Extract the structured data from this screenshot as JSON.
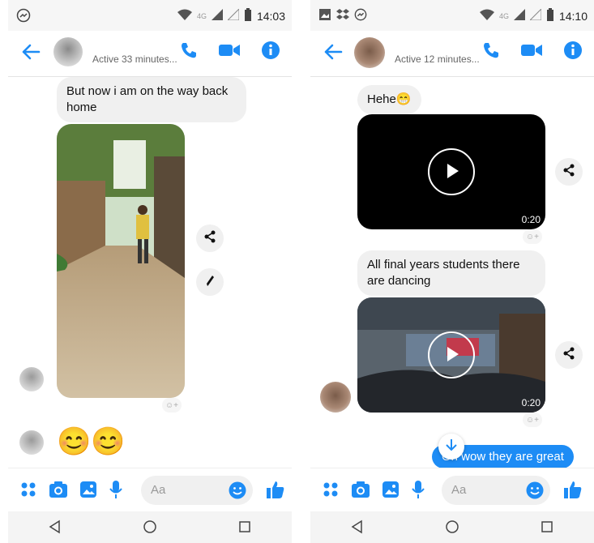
{
  "left": {
    "status": {
      "time": "14:03",
      "network": "4G"
    },
    "header": {
      "active": "Active 33 minutes..."
    },
    "messages": {
      "text1": "But now i am on the way back home",
      "emoji": "😊😊"
    },
    "composer": {
      "placeholder": "Aa"
    }
  },
  "right": {
    "status": {
      "time": "14:10",
      "network": "4G"
    },
    "header": {
      "active": "Active 12 minutes..."
    },
    "messages": {
      "hehe": "Hehe😁",
      "video1_duration": "0:20",
      "text2": "All final years students there are dancing",
      "video2_duration": "0:20",
      "outgoing": "Oh wow they are great"
    },
    "composer": {
      "placeholder": "Aa"
    }
  },
  "colors": {
    "accent": "#1d8cf5",
    "bubble": "#f0f0f0",
    "like": "#1d8cf5"
  }
}
